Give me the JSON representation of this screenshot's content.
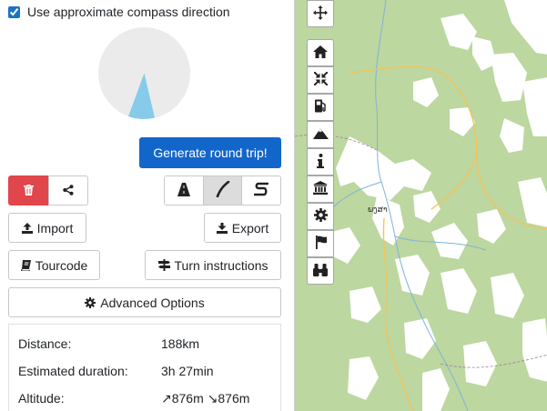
{
  "compass": {
    "checkbox_label": "Use approximate compass direction",
    "checked": true
  },
  "pie": {
    "background_color": "#ebebeb",
    "wedge_color": "#86cbea"
  },
  "buttons": {
    "generate": "Generate round trip!",
    "delete_icon": "trash-icon",
    "share_icon": "share-icon",
    "import": "Import",
    "export": "Export",
    "tourcode": "Tourcode",
    "turn_instructions": "Turn instructions",
    "advanced": "Advanced Options"
  },
  "route_styles": [
    {
      "icon": "road-icon",
      "active": false
    },
    {
      "icon": "curve-line-icon",
      "active": true
    },
    {
      "icon": "s-curve-icon",
      "active": false
    }
  ],
  "stats": [
    {
      "label": "Distance:",
      "value": "188km"
    },
    {
      "label": "Estimated duration:",
      "value": "3h 27min"
    },
    {
      "label": "Altitude:",
      "value": "↗876m ↘876m"
    }
  ],
  "map": {
    "town_label": "ພງສາ",
    "tools": [
      "move-icon",
      "home-icon",
      "shrink-icon",
      "fuel-icon",
      "mountain-icon",
      "info-icon",
      "museum-icon",
      "gear-icon",
      "flag-icon",
      "binoculars-icon"
    ],
    "land_color": "#bcd7a0",
    "clearing_color": "#ffffff"
  }
}
